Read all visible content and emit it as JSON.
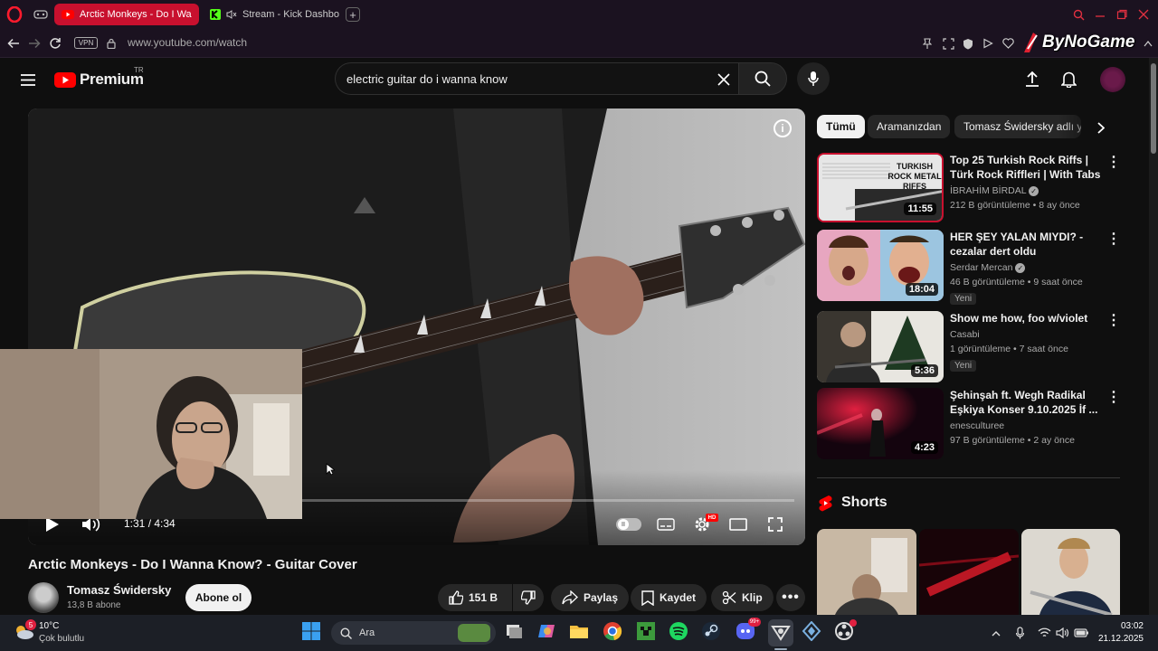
{
  "browser": {
    "tabs": [
      {
        "label": "Arctic Monkeys - Do I Wa",
        "active": true
      },
      {
        "label": "Stream - Kick Dashbo",
        "active": false
      }
    ],
    "vpn_label": "VPN",
    "url": "www.youtube.com/watch",
    "watermark": "ByNoGame"
  },
  "youtube": {
    "logo_text": "Premium",
    "country_code": "TR",
    "search_value": "electric guitar do i wanna know",
    "player": {
      "time": "1:31 / 4:34",
      "progress": 0.33,
      "quality_badge": "HD"
    },
    "video_title": "Arctic Monkeys - Do I Wanna Know? - Guitar Cover",
    "channel": {
      "name": "Tomasz Świdersky",
      "subs": "13,8 B abone",
      "subscribe_label": "Abone ol"
    },
    "actions": {
      "likes": "151 B",
      "share": "Paylaş",
      "save": "Kaydet",
      "clip": "Klip"
    },
    "chips": [
      "Tümü",
      "Aramanızdan",
      "Tomasz Świdersky adlı y"
    ],
    "recommendations": [
      {
        "title": "Top 25 Turkish Rock Riffs | Türk Rock Riffleri | With Tabs",
        "channel": "İBRAHİM BİRDAL",
        "meta": "212 B görüntüleme • 8 ay önce",
        "duration": "11:55",
        "thumb_text": "TURKISH ROCK METAL RIFFS",
        "new": ""
      },
      {
        "title": "HER ŞEY YALAN MIYDI? - cezalar dert oldu",
        "channel": "Serdar Mercan",
        "meta": "46 B görüntüleme • 9 saat önce",
        "duration": "18:04",
        "new": "Yeni"
      },
      {
        "title": "Show me how, foo w/violet",
        "channel": "Casabi",
        "meta": "1 görüntüleme • 7 saat önce",
        "duration": "5:36",
        "new": "Yeni"
      },
      {
        "title": "Şehinşah ft. Wegh Radikal Eşkiya Konser 9.10.2025 İf ...",
        "channel": "enesculturee",
        "meta": "97 B görüntüleme • 2 ay önce",
        "duration": "4:23",
        "new": ""
      }
    ],
    "shorts_label": "Shorts"
  },
  "taskbar": {
    "weather_temp": "10°C",
    "weather_desc": "Çok bulutlu",
    "weather_badge": "5",
    "search_label": "Ara",
    "discord_badge": "99+",
    "time": "03:02",
    "date": "21.12.2025"
  },
  "colors": {
    "yt_red": "#ff0000",
    "opera_red": "#ff1b2d",
    "tab_active": "#c8102e"
  }
}
